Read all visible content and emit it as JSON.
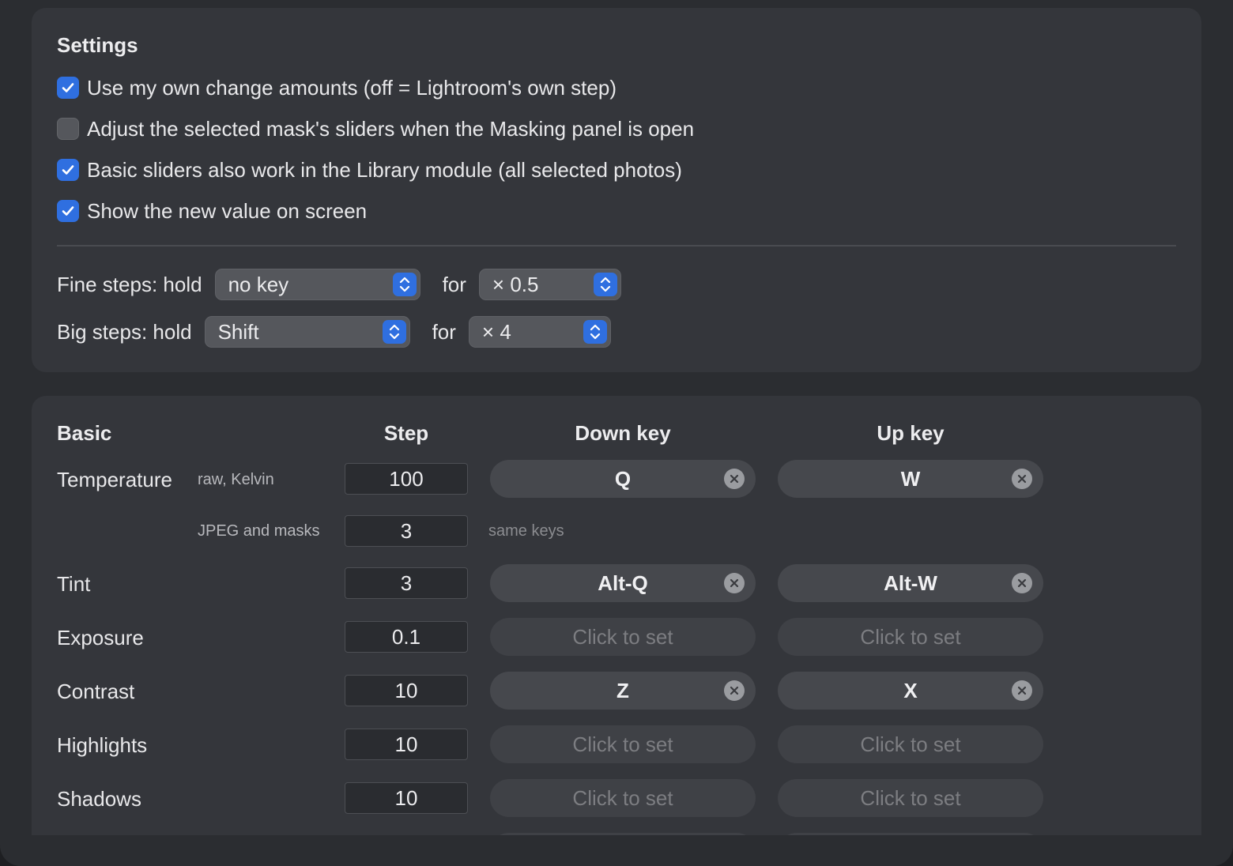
{
  "settings": {
    "title": "Settings",
    "options": [
      {
        "label": "Use my own change amounts (off = Lightroom's own step)",
        "checked": true
      },
      {
        "label": "Adjust the selected mask's sliders when the Masking panel is open",
        "checked": false
      },
      {
        "label": "Basic sliders also work in the Library module (all selected photos)",
        "checked": true
      },
      {
        "label": "Show the new value on screen",
        "checked": true
      }
    ],
    "fine": {
      "label": "Fine steps: hold",
      "key": "no key",
      "for_label": "for",
      "factor": "× 0.5"
    },
    "big": {
      "label": "Big steps: hold",
      "key": "Shift",
      "for_label": "for",
      "factor": "× 4"
    }
  },
  "basic": {
    "title": "Basic",
    "columns": {
      "step": "Step",
      "down": "Down key",
      "up": "Up key"
    },
    "temperature": {
      "label": "Temperature",
      "raw_sub": "raw, Kelvin",
      "raw_step": "100",
      "down": "Q",
      "up": "W",
      "jpeg_sub": "JPEG and masks",
      "jpeg_step": "3",
      "jpeg_note": "same keys"
    },
    "rows": [
      {
        "label": "Tint",
        "step": "3",
        "down": "Alt-Q",
        "up": "Alt-W"
      },
      {
        "label": "Exposure",
        "step": "0.1",
        "down": "Click to set",
        "up": "Click to set"
      },
      {
        "label": "Contrast",
        "step": "10",
        "down": "Z",
        "up": "X"
      },
      {
        "label": "Highlights",
        "step": "10",
        "down": "Click to set",
        "up": "Click to set"
      },
      {
        "label": "Shadows",
        "step": "10",
        "down": "Click to set",
        "up": "Click to set"
      }
    ]
  },
  "colors": {
    "accent": "#2f6fe0",
    "window": "#2b2d31",
    "card": "#34363b"
  },
  "icons": {
    "checkmark": "checkmark-icon",
    "stepper": "up-down-chevron-icon",
    "clear": "clear-x-icon"
  }
}
